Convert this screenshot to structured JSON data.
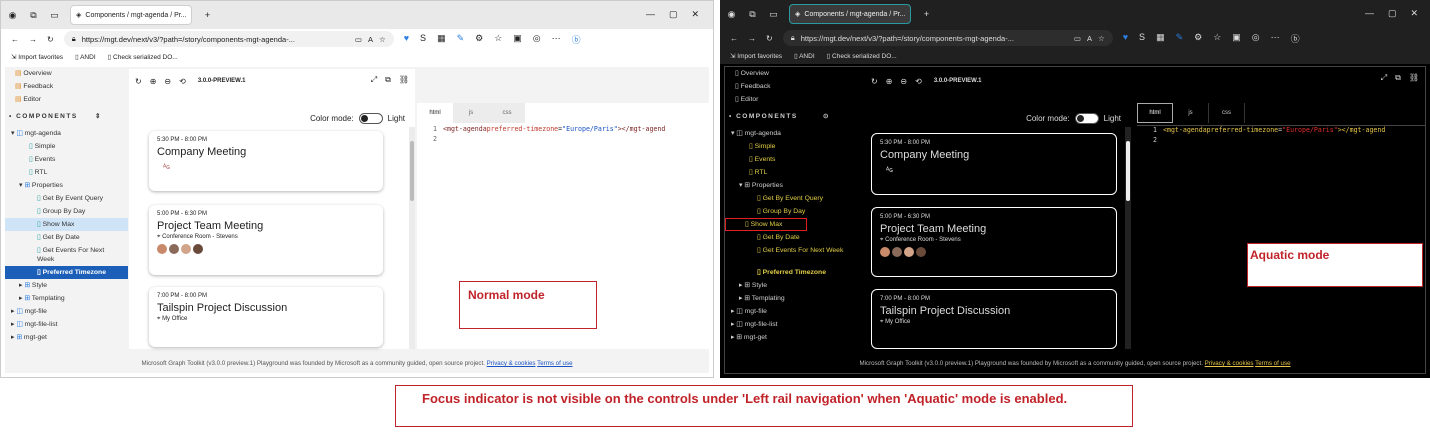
{
  "browser": {
    "tab_title": "Components / mgt-agenda / Pr...",
    "url": "https://mgt.dev/next/v3/?path=/story/components-mgt-agenda-...",
    "favorites": [
      "Import favorites",
      "ANDI",
      "Check serialized DO..."
    ]
  },
  "storybook": {
    "version": "3.0.0-PREVIEW.1",
    "color_mode_label": "Color mode:",
    "color_mode_value": "Light",
    "nav": {
      "top": [
        "Overview",
        "Feedback",
        "Editor"
      ],
      "section": "COMPONENTS",
      "agenda": "mgt-agenda",
      "agenda_items": [
        "Simple",
        "Events",
        "RTL"
      ],
      "properties": "Properties",
      "property_items": [
        "Get By Event Query",
        "Group By Day",
        "Show Max",
        "Get By Date",
        "Get Events For Next Week",
        "Preferred Timezone"
      ],
      "more": [
        "Style",
        "Templating"
      ],
      "components_more": [
        "mgt-file",
        "mgt-file-list",
        "mgt-get"
      ]
    },
    "events": [
      {
        "time": "5:30 PM - 8:00 PM",
        "title": "Company Meeting",
        "location": ""
      },
      {
        "time": "5:00 PM - 6:30 PM",
        "title": "Project Team Meeting",
        "location": "Conference Room - Stevens"
      },
      {
        "time": "7:00 PM - 8:00 PM",
        "title": "Tailspin Project Discussion",
        "location": "My Office"
      }
    ],
    "editor_tabs": [
      "html",
      "js",
      "css"
    ],
    "code_line_1_tag_open": "<mgt-agenda",
    "code_line_1_attr": " preferred-timezone",
    "code_line_1_eq": "=",
    "code_line_1_str": "\"Europe/Paris\"",
    "code_line_1_tag_close": "></mgt-agend",
    "line_numbers": [
      "1",
      "2"
    ],
    "footer_text": "Microsoft Graph Toolkit (v3.0.0 preview.1) Playground was founded by Microsoft as a community guided, open source project.",
    "footer_privacy": "Privacy & cookies",
    "footer_terms": "Terms of use"
  },
  "annotations": {
    "normal": "Normal mode",
    "aquatic": "Aquatic mode",
    "focus_issue": "Focus indicator is not visible on the controls under 'Left rail navigation' when 'Aquatic' mode is enabled."
  },
  "colors": {
    "annotation_red": "#c0232a",
    "aquatic_link": "#e2ce47",
    "selected_light": "#1b5fb8"
  }
}
